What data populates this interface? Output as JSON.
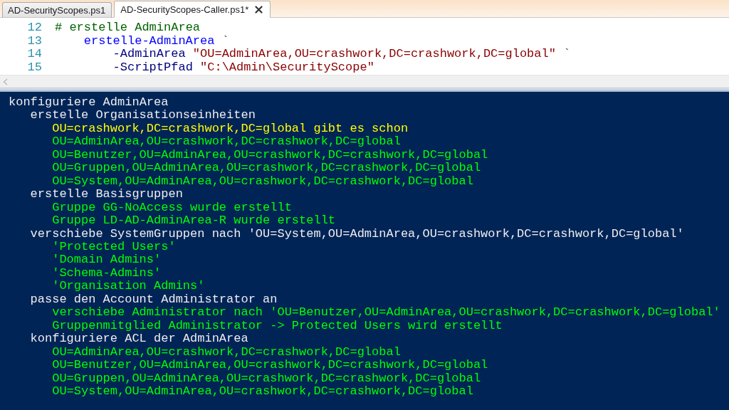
{
  "tabs": [
    {
      "label": "AD-SecurityScopes.ps1",
      "selected": false
    },
    {
      "label": "AD-SecurityScopes-Caller.ps1*",
      "selected": true
    }
  ],
  "editor": {
    "lines": [
      {
        "number": "12",
        "tokens": [
          {
            "kind": "comment",
            "text": "# erstelle AdminArea"
          }
        ],
        "children": [
          {
            "number": "13",
            "tokens": [
              {
                "kind": "command",
                "text": "erstelle-AdminArea"
              },
              {
                "kind": "continuation",
                "text": "`"
              }
            ],
            "children": [
              {
                "number": "14",
                "tokens": [
                  {
                    "kind": "parameter",
                    "text": "-AdminArea"
                  },
                  {
                    "kind": "string",
                    "text": "\"OU=AdminArea,OU=crashwork,DC=crashwork,DC=global\""
                  },
                  {
                    "kind": "continuation",
                    "text": "`"
                  }
                ]
              },
              {
                "number": "15",
                "tokens": [
                  {
                    "kind": "parameter",
                    "text": "-ScriptPfad"
                  },
                  {
                    "kind": "string",
                    "text": "\"C:\\Admin\\SecurityScope\""
                  }
                ]
              }
            ]
          }
        ]
      }
    ]
  },
  "console": {
    "lines": [
      {
        "text": "konfiguriere AdminArea",
        "color": "#eeedf0",
        "children": [
          {
            "text": "erstelle Organisationseinheiten",
            "color": "#eeedf0",
            "children": [
              {
                "text": "OU=crashwork,DC=crashwork,DC=global gibt es schon",
                "color": "#ffff00"
              },
              {
                "text": "OU=AdminArea,OU=crashwork,DC=crashwork,DC=global",
                "color": "#00ff00"
              },
              {
                "text": "OU=Benutzer,OU=AdminArea,OU=crashwork,DC=crashwork,DC=global",
                "color": "#00ff00"
              },
              {
                "text": "OU=Gruppen,OU=AdminArea,OU=crashwork,DC=crashwork,DC=global",
                "color": "#00ff00"
              },
              {
                "text": "OU=System,OU=AdminArea,OU=crashwork,DC=crashwork,DC=global",
                "color": "#00ff00"
              }
            ]
          },
          {
            "text": "erstelle Basisgruppen",
            "color": "#eeedf0",
            "children": [
              {
                "text": "Gruppe GG-NoAccess wurde erstellt",
                "color": "#00ff00"
              },
              {
                "text": "Gruppe LD-AD-AdminArea-R wurde erstellt",
                "color": "#00ff00"
              }
            ]
          },
          {
            "text": "verschiebe SystemGruppen nach 'OU=System,OU=AdminArea,OU=crashwork,DC=crashwork,DC=global'",
            "color": "#eeedf0",
            "children": [
              {
                "text": "'Protected Users'",
                "color": "#00ff00"
              },
              {
                "text": "'Domain Admins'",
                "color": "#00ff00"
              },
              {
                "text": "'Schema-Admins'",
                "color": "#00ff00"
              },
              {
                "text": "'Organisation Admins'",
                "color": "#00ff00"
              }
            ]
          },
          {
            "text": "passe den Account Administrator an",
            "color": "#eeedf0",
            "children": [
              {
                "text": "verschiebe Administrator nach 'OU=Benutzer,OU=AdminArea,OU=crashwork,DC=crashwork,DC=global'",
                "color": "#00ff00"
              },
              {
                "text": "Gruppenmitglied Administrator -> Protected Users wird erstellt",
                "color": "#00ff00"
              }
            ]
          },
          {
            "text": "konfiguriere ACL der AdminArea",
            "color": "#eeedf0",
            "children": [
              {
                "text": "OU=AdminArea,OU=crashwork,DC=crashwork,DC=global",
                "color": "#00ff00"
              },
              {
                "text": "OU=Benutzer,OU=AdminArea,OU=crashwork,DC=crashwork,DC=global",
                "color": "#00ff00"
              },
              {
                "text": "OU=Gruppen,OU=AdminArea,OU=crashwork,DC=crashwork,DC=global",
                "color": "#00ff00"
              },
              {
                "text": "OU=System,OU=AdminArea,OU=crashwork,DC=crashwork,DC=global",
                "color": "#00ff00"
              }
            ]
          }
        ]
      }
    ]
  }
}
